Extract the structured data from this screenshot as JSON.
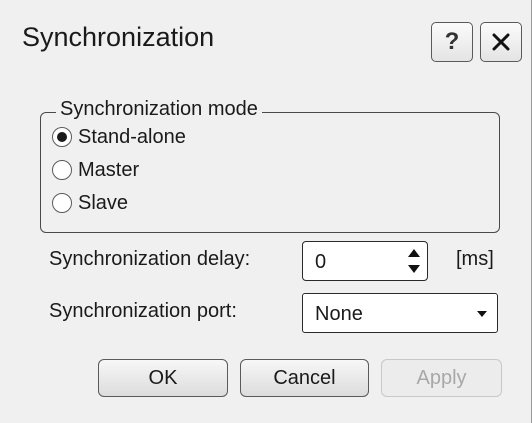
{
  "window": {
    "title": "Synchronization",
    "help_label": "?",
    "close_icon": "close-icon"
  },
  "mode_group": {
    "title": "Synchronization mode",
    "options": [
      {
        "label": "Stand-alone",
        "selected": true
      },
      {
        "label": "Master",
        "selected": false
      },
      {
        "label": "Slave",
        "selected": false
      }
    ]
  },
  "delay": {
    "label": "Synchronization delay:",
    "value": "0",
    "unit": "[ms]"
  },
  "port": {
    "label": "Synchronization port:",
    "value": "None"
  },
  "buttons": {
    "ok": "OK",
    "cancel": "Cancel",
    "apply": "Apply",
    "apply_enabled": false
  }
}
